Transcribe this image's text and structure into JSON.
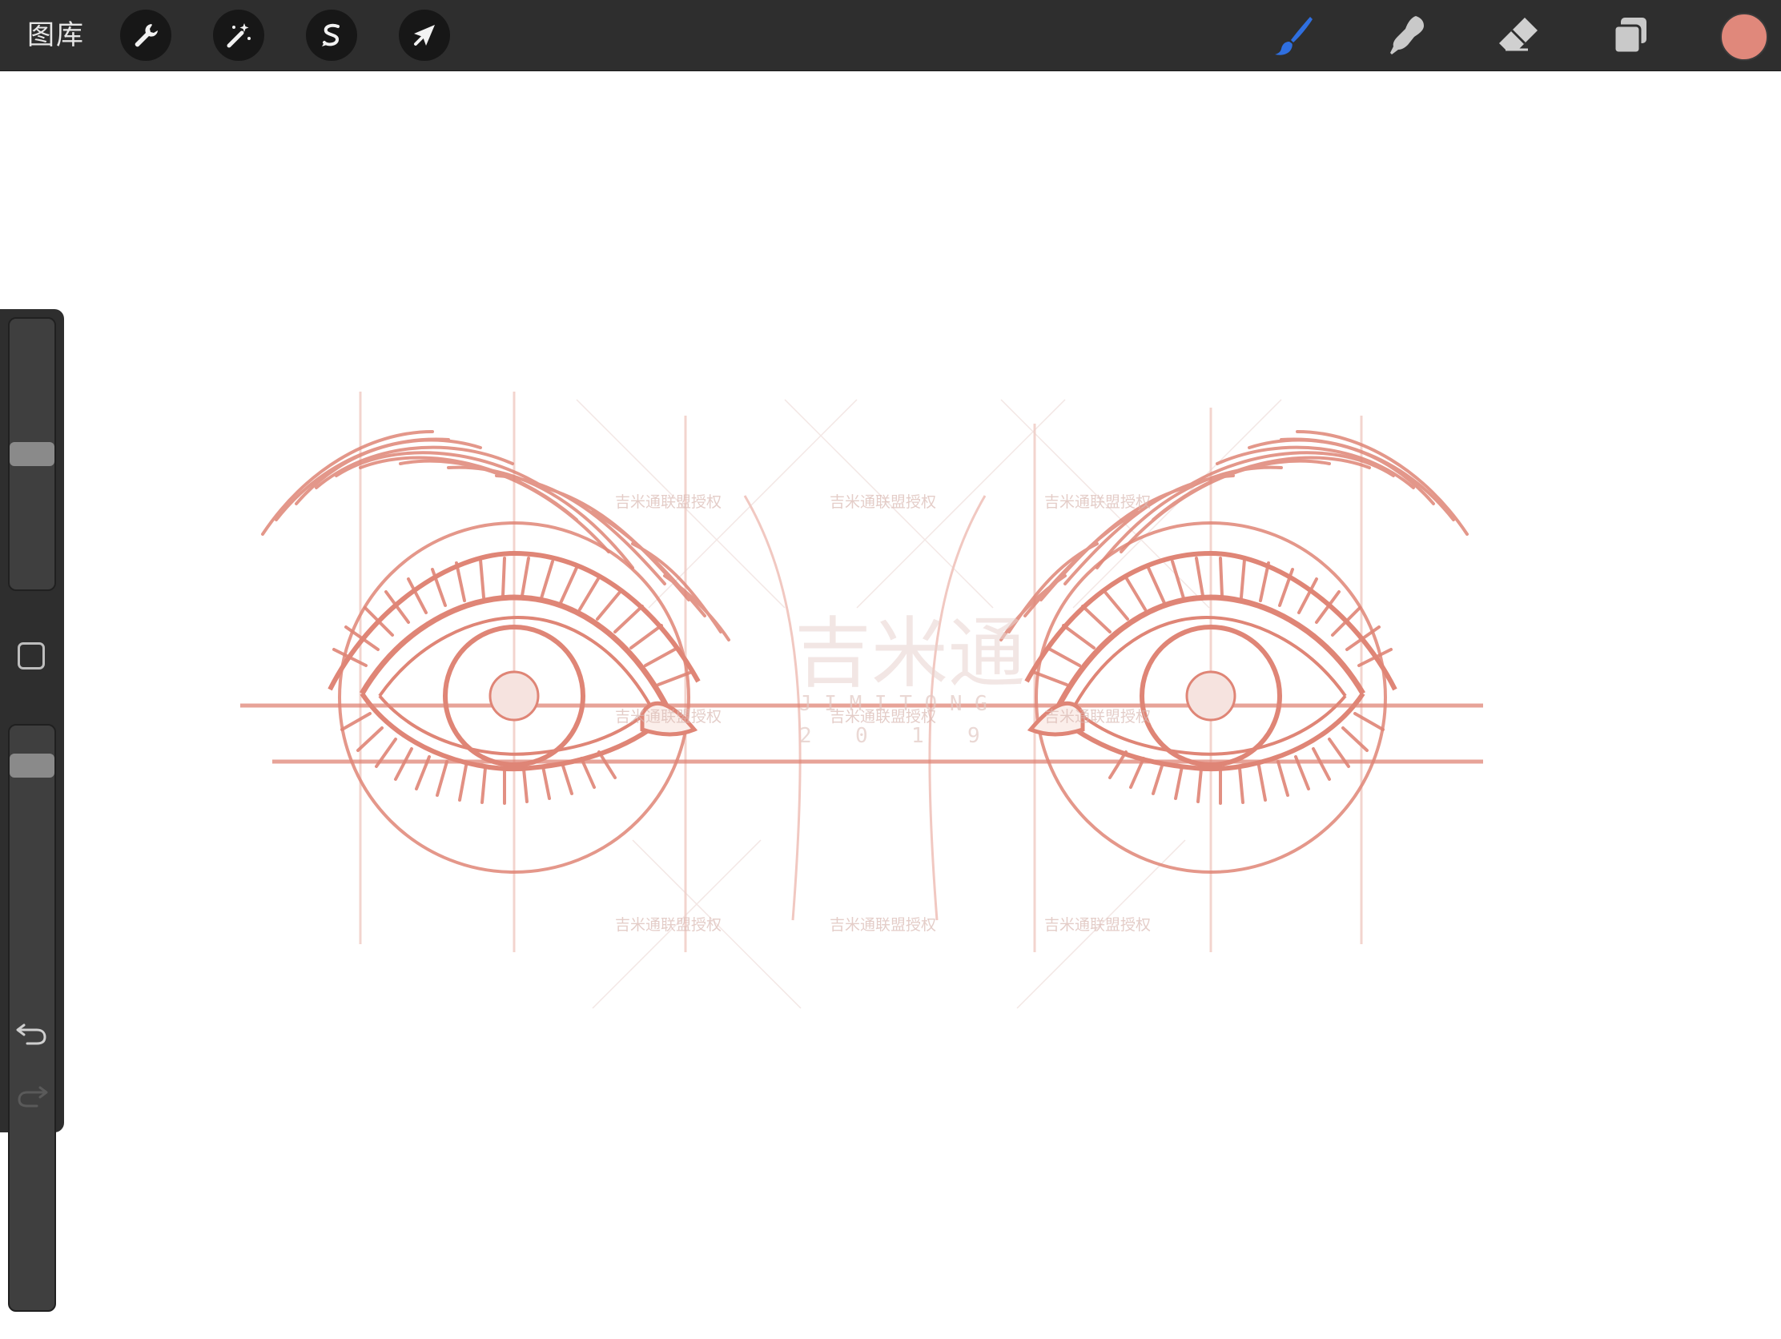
{
  "toolbar": {
    "gallery_label": "图库",
    "left_tools": [
      {
        "icon": "wrench-icon",
        "name": "actions"
      },
      {
        "icon": "magic-wand-icon",
        "name": "adjustments"
      },
      {
        "icon": "selection-s-icon",
        "name": "selection"
      },
      {
        "icon": "arrow-cursor-icon",
        "name": "transform"
      }
    ],
    "right_tools": [
      {
        "icon": "brush-icon",
        "name": "paint",
        "active": true
      },
      {
        "icon": "smudge-icon",
        "name": "smudge"
      },
      {
        "icon": "eraser-icon",
        "name": "eraser"
      },
      {
        "icon": "layers-icon",
        "name": "layers"
      }
    ],
    "current_color": "#e0887b",
    "active_tool_color": "#2f6fe0"
  },
  "sidebar": {
    "brush_size_level": 0.5,
    "opacity_level": 0.95,
    "undo_icon": "undo-icon",
    "redo_icon": "redo-icon"
  },
  "canvas": {
    "watermark_title": "吉米通",
    "watermark_small": "吉米通联盟授权",
    "watermark_latin": "J I M I T O N G",
    "watermark_year": [
      "2",
      "0",
      "1",
      "9"
    ],
    "stroke_color": "#df8576"
  }
}
